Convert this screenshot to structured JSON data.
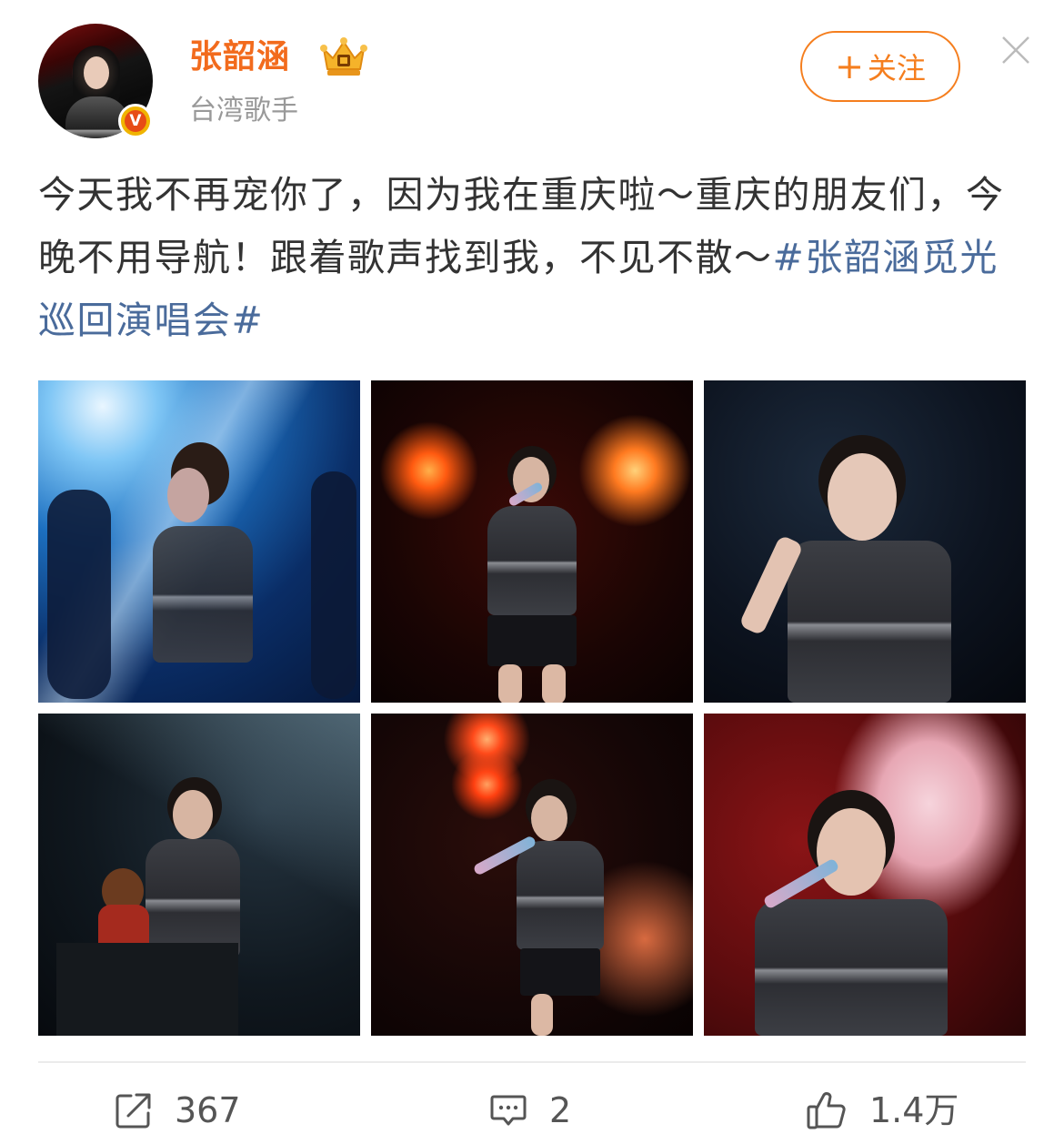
{
  "user": {
    "name": "张韶涵",
    "description": "台湾歌手",
    "verified_badge": "V",
    "vip_icon": "crown-icon"
  },
  "follow_button": {
    "plus": "+",
    "label": "关注"
  },
  "post": {
    "text_1": "今天我不再宠你了，因为我在重庆啦～重庆的朋友们，今晚不用导航！跟着歌声找到我，不见不散～",
    "hashtag": "#张韶涵觅光巡回演唱会#"
  },
  "photos": [
    {
      "scene": "blue-stage-light"
    },
    {
      "scene": "red-stage-singing"
    },
    {
      "scene": "dark-stage-smiling"
    },
    {
      "scene": "stage-with-monkey-doll"
    },
    {
      "scene": "red-lights-singing"
    },
    {
      "scene": "pink-flower-background"
    }
  ],
  "actions": {
    "repost_count": "367",
    "comment_count": "2",
    "like_count": "1.4万"
  },
  "colors": {
    "username": "#f26b1d",
    "follow": "#f57e1e",
    "hashtag": "#4a6b9b"
  }
}
